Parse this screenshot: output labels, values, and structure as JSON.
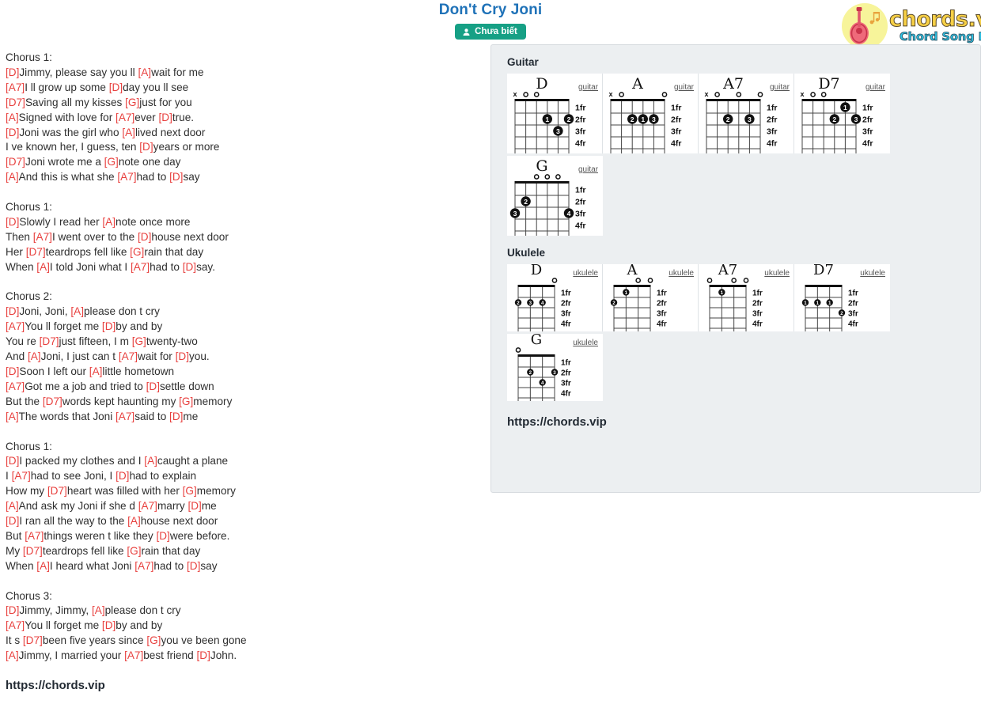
{
  "header": {
    "song_title": "Don't Cry Joni",
    "badge_label": "Chưa biết",
    "badge_icon": "user-icon",
    "badge_color": "#16a085",
    "title_color": "#1f72b8",
    "logo": {
      "main": "chords.vip",
      "sub": "Chord Song Lyric",
      "icon": "guitar-icon",
      "main_color": "#f7d046",
      "sub_color": "#2ec4e6",
      "circle_color": "#f7f49a"
    }
  },
  "lyrics": {
    "chord_color": "#e8413f",
    "blocks": [
      {
        "type": "head",
        "text": "Chorus 1:"
      },
      {
        "type": "line",
        "parts": [
          [
            "c",
            "[D]"
          ],
          [
            "t",
            "Jimmy, please say you ll "
          ],
          [
            "c",
            "[A]"
          ],
          [
            "t",
            "wait for me"
          ]
        ]
      },
      {
        "type": "line",
        "parts": [
          [
            "c",
            "[A7]"
          ],
          [
            "t",
            "I ll grow up some "
          ],
          [
            "c",
            "[D]"
          ],
          [
            "t",
            "day you ll see"
          ]
        ]
      },
      {
        "type": "line",
        "parts": [
          [
            "c",
            "[D7]"
          ],
          [
            "t",
            "Saving all my kisses "
          ],
          [
            "c",
            "[G]"
          ],
          [
            "t",
            "just for you"
          ]
        ]
      },
      {
        "type": "line",
        "parts": [
          [
            "c",
            "[A]"
          ],
          [
            "t",
            "Signed with love for "
          ],
          [
            "c",
            "[A7]"
          ],
          [
            "t",
            "ever "
          ],
          [
            "c",
            "[D]"
          ],
          [
            "t",
            "true."
          ]
        ]
      },
      {
        "type": "line",
        "parts": [
          [
            "c",
            "[D]"
          ],
          [
            "t",
            "Joni was the girl who "
          ],
          [
            "c",
            "[A]"
          ],
          [
            "t",
            "lived next door"
          ]
        ]
      },
      {
        "type": "line",
        "parts": [
          [
            "t",
            "I ve known her, I guess, ten "
          ],
          [
            "c",
            "[D]"
          ],
          [
            "t",
            "years or more"
          ]
        ]
      },
      {
        "type": "line",
        "parts": [
          [
            "c",
            "[D7]"
          ],
          [
            "t",
            "Joni wrote me a "
          ],
          [
            "c",
            "[G]"
          ],
          [
            "t",
            "note one day"
          ]
        ]
      },
      {
        "type": "line",
        "parts": [
          [
            "c",
            "[A]"
          ],
          [
            "t",
            "And this is what she "
          ],
          [
            "c",
            "[A7]"
          ],
          [
            "t",
            "had to "
          ],
          [
            "c",
            "[D]"
          ],
          [
            "t",
            "say"
          ]
        ]
      },
      {
        "type": "blank"
      },
      {
        "type": "head",
        "text": "Chorus 1:"
      },
      {
        "type": "line",
        "parts": [
          [
            "c",
            "[D]"
          ],
          [
            "t",
            "Slowly I read her "
          ],
          [
            "c",
            "[A]"
          ],
          [
            "t",
            "note once more"
          ]
        ]
      },
      {
        "type": "line",
        "parts": [
          [
            "t",
            "Then "
          ],
          [
            "c",
            "[A7]"
          ],
          [
            "t",
            "I went over to the "
          ],
          [
            "c",
            "[D]"
          ],
          [
            "t",
            "house next door"
          ]
        ]
      },
      {
        "type": "line",
        "parts": [
          [
            "t",
            "Her "
          ],
          [
            "c",
            "[D7]"
          ],
          [
            "t",
            "teardrops fell like "
          ],
          [
            "c",
            "[G]"
          ],
          [
            "t",
            "rain that day"
          ]
        ]
      },
      {
        "type": "line",
        "parts": [
          [
            "t",
            "When "
          ],
          [
            "c",
            "[A]"
          ],
          [
            "t",
            "I told Joni what I "
          ],
          [
            "c",
            "[A7]"
          ],
          [
            "t",
            "had to "
          ],
          [
            "c",
            "[D]"
          ],
          [
            "t",
            "say."
          ]
        ]
      },
      {
        "type": "blank"
      },
      {
        "type": "head",
        "text": "Chorus 2:"
      },
      {
        "type": "line",
        "parts": [
          [
            "c",
            "[D]"
          ],
          [
            "t",
            "Joni, Joni, "
          ],
          [
            "c",
            "[A]"
          ],
          [
            "t",
            "please don t cry"
          ]
        ]
      },
      {
        "type": "line",
        "parts": [
          [
            "c",
            "[A7]"
          ],
          [
            "t",
            "You ll forget me "
          ],
          [
            "c",
            "[D]"
          ],
          [
            "t",
            "by and by"
          ]
        ]
      },
      {
        "type": "line",
        "parts": [
          [
            "t",
            "You re "
          ],
          [
            "c",
            "[D7]"
          ],
          [
            "t",
            "just fifteen, I m "
          ],
          [
            "c",
            "[G]"
          ],
          [
            "t",
            "twenty-two"
          ]
        ]
      },
      {
        "type": "line",
        "parts": [
          [
            "t",
            "And "
          ],
          [
            "c",
            "[A]"
          ],
          [
            "t",
            "Joni, I just can t "
          ],
          [
            "c",
            "[A7]"
          ],
          [
            "t",
            "wait for "
          ],
          [
            "c",
            "[D]"
          ],
          [
            "t",
            "you."
          ]
        ]
      },
      {
        "type": "line",
        "parts": [
          [
            "c",
            "[D]"
          ],
          [
            "t",
            "Soon I left our "
          ],
          [
            "c",
            "[A]"
          ],
          [
            "t",
            "little hometown"
          ]
        ]
      },
      {
        "type": "line",
        "parts": [
          [
            "c",
            "[A7]"
          ],
          [
            "t",
            "Got me a job and tried to "
          ],
          [
            "c",
            "[D]"
          ],
          [
            "t",
            "settle down"
          ]
        ]
      },
      {
        "type": "line",
        "parts": [
          [
            "t",
            "But the "
          ],
          [
            "c",
            "[D7]"
          ],
          [
            "t",
            "words kept haunting my "
          ],
          [
            "c",
            "[G]"
          ],
          [
            "t",
            "memory"
          ]
        ]
      },
      {
        "type": "line",
        "parts": [
          [
            "c",
            "[A]"
          ],
          [
            "t",
            "The words that Joni "
          ],
          [
            "c",
            "[A7]"
          ],
          [
            "t",
            "said to "
          ],
          [
            "c",
            "[D]"
          ],
          [
            "t",
            "me"
          ]
        ]
      },
      {
        "type": "blank"
      },
      {
        "type": "head",
        "text": "Chorus 1:"
      },
      {
        "type": "line",
        "parts": [
          [
            "c",
            "[D]"
          ],
          [
            "t",
            "I packed my clothes and I "
          ],
          [
            "c",
            "[A]"
          ],
          [
            "t",
            "caught a plane"
          ]
        ]
      },
      {
        "type": "line",
        "parts": [
          [
            "t",
            "I "
          ],
          [
            "c",
            "[A7]"
          ],
          [
            "t",
            "had to see Joni, I "
          ],
          [
            "c",
            "[D]"
          ],
          [
            "t",
            "had to explain"
          ]
        ]
      },
      {
        "type": "line",
        "parts": [
          [
            "t",
            "How my "
          ],
          [
            "c",
            "[D7]"
          ],
          [
            "t",
            "heart was filled with her "
          ],
          [
            "c",
            "[G]"
          ],
          [
            "t",
            "memory"
          ]
        ]
      },
      {
        "type": "line",
        "parts": [
          [
            "c",
            "[A]"
          ],
          [
            "t",
            "And ask my Joni if she d "
          ],
          [
            "c",
            "[A7]"
          ],
          [
            "t",
            "marry "
          ],
          [
            "c",
            "[D]"
          ],
          [
            "t",
            "me"
          ]
        ]
      },
      {
        "type": "line",
        "parts": [
          [
            "c",
            "[D]"
          ],
          [
            "t",
            "I ran all the way to the "
          ],
          [
            "c",
            "[A]"
          ],
          [
            "t",
            "house next door"
          ]
        ]
      },
      {
        "type": "line",
        "parts": [
          [
            "t",
            "But "
          ],
          [
            "c",
            "[A7]"
          ],
          [
            "t",
            "things weren t like they "
          ],
          [
            "c",
            "[D]"
          ],
          [
            "t",
            "were before."
          ]
        ]
      },
      {
        "type": "line",
        "parts": [
          [
            "t",
            "My "
          ],
          [
            "c",
            "[D7]"
          ],
          [
            "t",
            "teardrops fell like "
          ],
          [
            "c",
            "[G]"
          ],
          [
            "t",
            "rain that day"
          ]
        ]
      },
      {
        "type": "line",
        "parts": [
          [
            "t",
            "When "
          ],
          [
            "c",
            "[A]"
          ],
          [
            "t",
            "I heard what Joni "
          ],
          [
            "c",
            "[A7]"
          ],
          [
            "t",
            "had to "
          ],
          [
            "c",
            "[D]"
          ],
          [
            "t",
            "say"
          ]
        ]
      },
      {
        "type": "blank"
      },
      {
        "type": "head",
        "text": "Chorus 3:"
      },
      {
        "type": "line",
        "parts": [
          [
            "c",
            "[D]"
          ],
          [
            "t",
            "Jimmy, Jimmy, "
          ],
          [
            "c",
            "[A]"
          ],
          [
            "t",
            "please don t cry"
          ]
        ]
      },
      {
        "type": "line",
        "parts": [
          [
            "c",
            "[A7]"
          ],
          [
            "t",
            "You ll forget me "
          ],
          [
            "c",
            "[D]"
          ],
          [
            "t",
            "by and by"
          ]
        ]
      },
      {
        "type": "line",
        "parts": [
          [
            "t",
            "It s "
          ],
          [
            "c",
            "[D7]"
          ],
          [
            "t",
            "been five years since "
          ],
          [
            "c",
            "[G]"
          ],
          [
            "t",
            "you ve been gone"
          ]
        ]
      },
      {
        "type": "line",
        "parts": [
          [
            "c",
            "[A]"
          ],
          [
            "t",
            "Jimmy, I married your "
          ],
          [
            "c",
            "[A7]"
          ],
          [
            "t",
            "best friend "
          ],
          [
            "c",
            "[D]"
          ],
          [
            "t",
            "John."
          ]
        ]
      }
    ],
    "site_url": "https://chords.vip"
  },
  "panel": {
    "guitar_heading": "Guitar",
    "ukulele_heading": "Ukulele",
    "fret_labels": [
      "1fr",
      "2fr",
      "3fr",
      "4fr"
    ],
    "instrument_label_guitar": "guitar",
    "instrument_label_ukulele": "ukulele",
    "site_url": "https://chords.vip",
    "guitar_chords": [
      {
        "name": "D",
        "instrument": "guitar",
        "strings": 6,
        "open_marks": [
          "x",
          "o",
          "o",
          "",
          "",
          ""
        ],
        "dots": [
          {
            "string": 4,
            "fret": 2,
            "finger": "1"
          },
          {
            "string": 6,
            "fret": 2,
            "finger": "2"
          },
          {
            "string": 5,
            "fret": 3,
            "finger": "3"
          }
        ]
      },
      {
        "name": "A",
        "instrument": "guitar",
        "strings": 6,
        "open_marks": [
          "x",
          "o",
          "",
          "",
          "",
          "o"
        ],
        "dots": [
          {
            "string": 3,
            "fret": 2,
            "finger": "2"
          },
          {
            "string": 4,
            "fret": 2,
            "finger": "1"
          },
          {
            "string": 5,
            "fret": 2,
            "finger": "3"
          }
        ]
      },
      {
        "name": "A7",
        "instrument": "guitar",
        "strings": 6,
        "open_marks": [
          "x",
          "o",
          "",
          "o",
          "",
          "o"
        ],
        "dots": [
          {
            "string": 3,
            "fret": 2,
            "finger": "2"
          },
          {
            "string": 5,
            "fret": 2,
            "finger": "3"
          }
        ]
      },
      {
        "name": "D7",
        "instrument": "guitar",
        "strings": 6,
        "open_marks": [
          "x",
          "o",
          "o",
          "",
          "",
          ""
        ],
        "dots": [
          {
            "string": 5,
            "fret": 1,
            "finger": "1"
          },
          {
            "string": 4,
            "fret": 2,
            "finger": "2"
          },
          {
            "string": 6,
            "fret": 2,
            "finger": "3"
          }
        ]
      },
      {
        "name": "G",
        "instrument": "guitar",
        "strings": 6,
        "open_marks": [
          "",
          "",
          "o",
          "o",
          "o",
          ""
        ],
        "dots": [
          {
            "string": 2,
            "fret": 2,
            "finger": "2"
          },
          {
            "string": 1,
            "fret": 3,
            "finger": "3"
          },
          {
            "string": 6,
            "fret": 3,
            "finger": "4"
          }
        ]
      }
    ],
    "ukulele_chords": [
      {
        "name": "D",
        "instrument": "ukulele",
        "strings": 4,
        "open_marks": [
          "",
          "",
          "",
          "o"
        ],
        "dots": [
          {
            "string": 1,
            "fret": 2,
            "finger": "2"
          },
          {
            "string": 2,
            "fret": 2,
            "finger": "3"
          },
          {
            "string": 3,
            "fret": 2,
            "finger": "4"
          }
        ]
      },
      {
        "name": "A",
        "instrument": "ukulele",
        "strings": 4,
        "open_marks": [
          "",
          "",
          "o",
          "o"
        ],
        "dots": [
          {
            "string": 2,
            "fret": 1,
            "finger": "1"
          },
          {
            "string": 1,
            "fret": 2,
            "finger": "2"
          }
        ]
      },
      {
        "name": "A7",
        "instrument": "ukulele",
        "strings": 4,
        "open_marks": [
          "o",
          "",
          "o",
          "o"
        ],
        "dots": [
          {
            "string": 2,
            "fret": 1,
            "finger": "1"
          }
        ]
      },
      {
        "name": "D7",
        "instrument": "ukulele",
        "strings": 4,
        "open_marks": [
          "",
          "",
          "",
          ""
        ],
        "dots": [
          {
            "string": 1,
            "fret": 2,
            "finger": "1"
          },
          {
            "string": 2,
            "fret": 2,
            "finger": "1"
          },
          {
            "string": 3,
            "fret": 2,
            "finger": "1"
          },
          {
            "string": 4,
            "fret": 3,
            "finger": "2"
          }
        ]
      },
      {
        "name": "G",
        "instrument": "ukulele",
        "strings": 4,
        "open_marks": [
          "o",
          "",
          "",
          ""
        ],
        "dots": [
          {
            "string": 2,
            "fret": 2,
            "finger": "2"
          },
          {
            "string": 4,
            "fret": 2,
            "finger": "3"
          },
          {
            "string": 3,
            "fret": 3,
            "finger": "4"
          }
        ]
      }
    ]
  }
}
